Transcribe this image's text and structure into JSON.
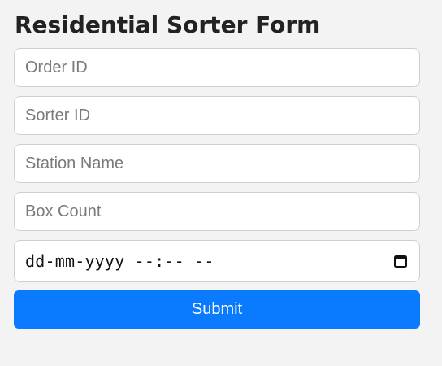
{
  "page": {
    "title": "Residential Sorter Form"
  },
  "form": {
    "order_id": {
      "placeholder": "Order ID",
      "value": ""
    },
    "sorter_id": {
      "placeholder": "Sorter ID",
      "value": ""
    },
    "station_name": {
      "placeholder": "Station Name",
      "value": ""
    },
    "box_count": {
      "placeholder": "Box Count",
      "value": ""
    },
    "datetime": {
      "display": "dd-mm-yyyy --:-- --",
      "icon": "calendar-icon"
    },
    "submit_label": "Submit"
  },
  "colors": {
    "background": "#f3f3f3",
    "submit_bg": "#0a7bff",
    "submit_text": "#ffffff",
    "title_text": "#222222",
    "field_border": "#cfcfcf"
  }
}
